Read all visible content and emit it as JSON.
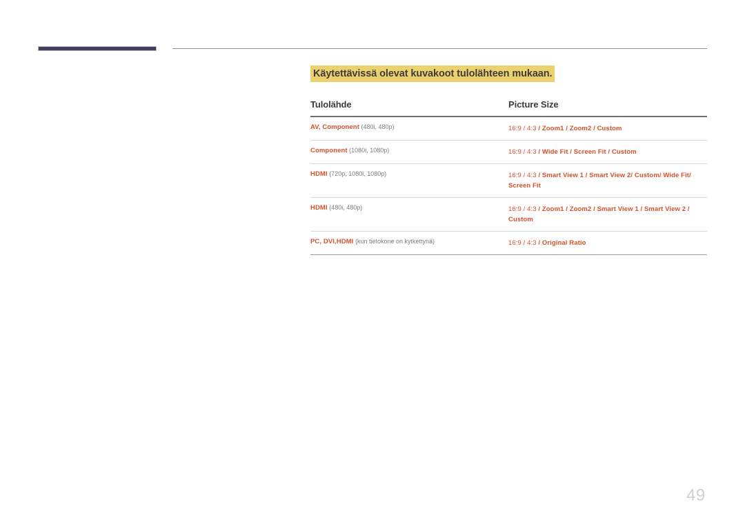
{
  "page": {
    "number": "49",
    "header_accent_color": "#453c55",
    "highlight_color": "#ecd16e",
    "accent_text_color": "#d8502a"
  },
  "section": {
    "title": "Käytettävissä olevat kuvakoot tulolähteen mukaan."
  },
  "table": {
    "headers": {
      "source": "Tulolähde",
      "picture_size": "Picture Size"
    },
    "rows": [
      {
        "source_name": "AV, Component",
        "source_resolution": "(480i, 480p)",
        "picture_size": "16:9 / 4:3 / Zoom1 / Zoom2 / Custom"
      },
      {
        "source_name": "Component",
        "source_resolution": "(1080i, 1080p)",
        "picture_size": "16:9 / 4:3 / Wide Fit / Screen Fit / Custom"
      },
      {
        "source_name": "HDMI",
        "source_resolution": "(720p, 1080i, 1080p)",
        "picture_size": "16:9 / 4:3 / Smart View 1 / Smart View 2/ Custom/ Wide Fit/ Screen Fit"
      },
      {
        "source_name": "HDMI",
        "source_resolution": "(480i, 480p)",
        "picture_size": "16:9 / 4:3 / Zoom1 / Zoom2 / Smart View 1 / Smart View 2 / Custom"
      },
      {
        "source_name": "PC, DVI,HDMI",
        "source_resolution": "(kun tietokone on kytkettynä)",
        "picture_size": "16:9 / 4:3 / Original Ratio"
      }
    ]
  }
}
